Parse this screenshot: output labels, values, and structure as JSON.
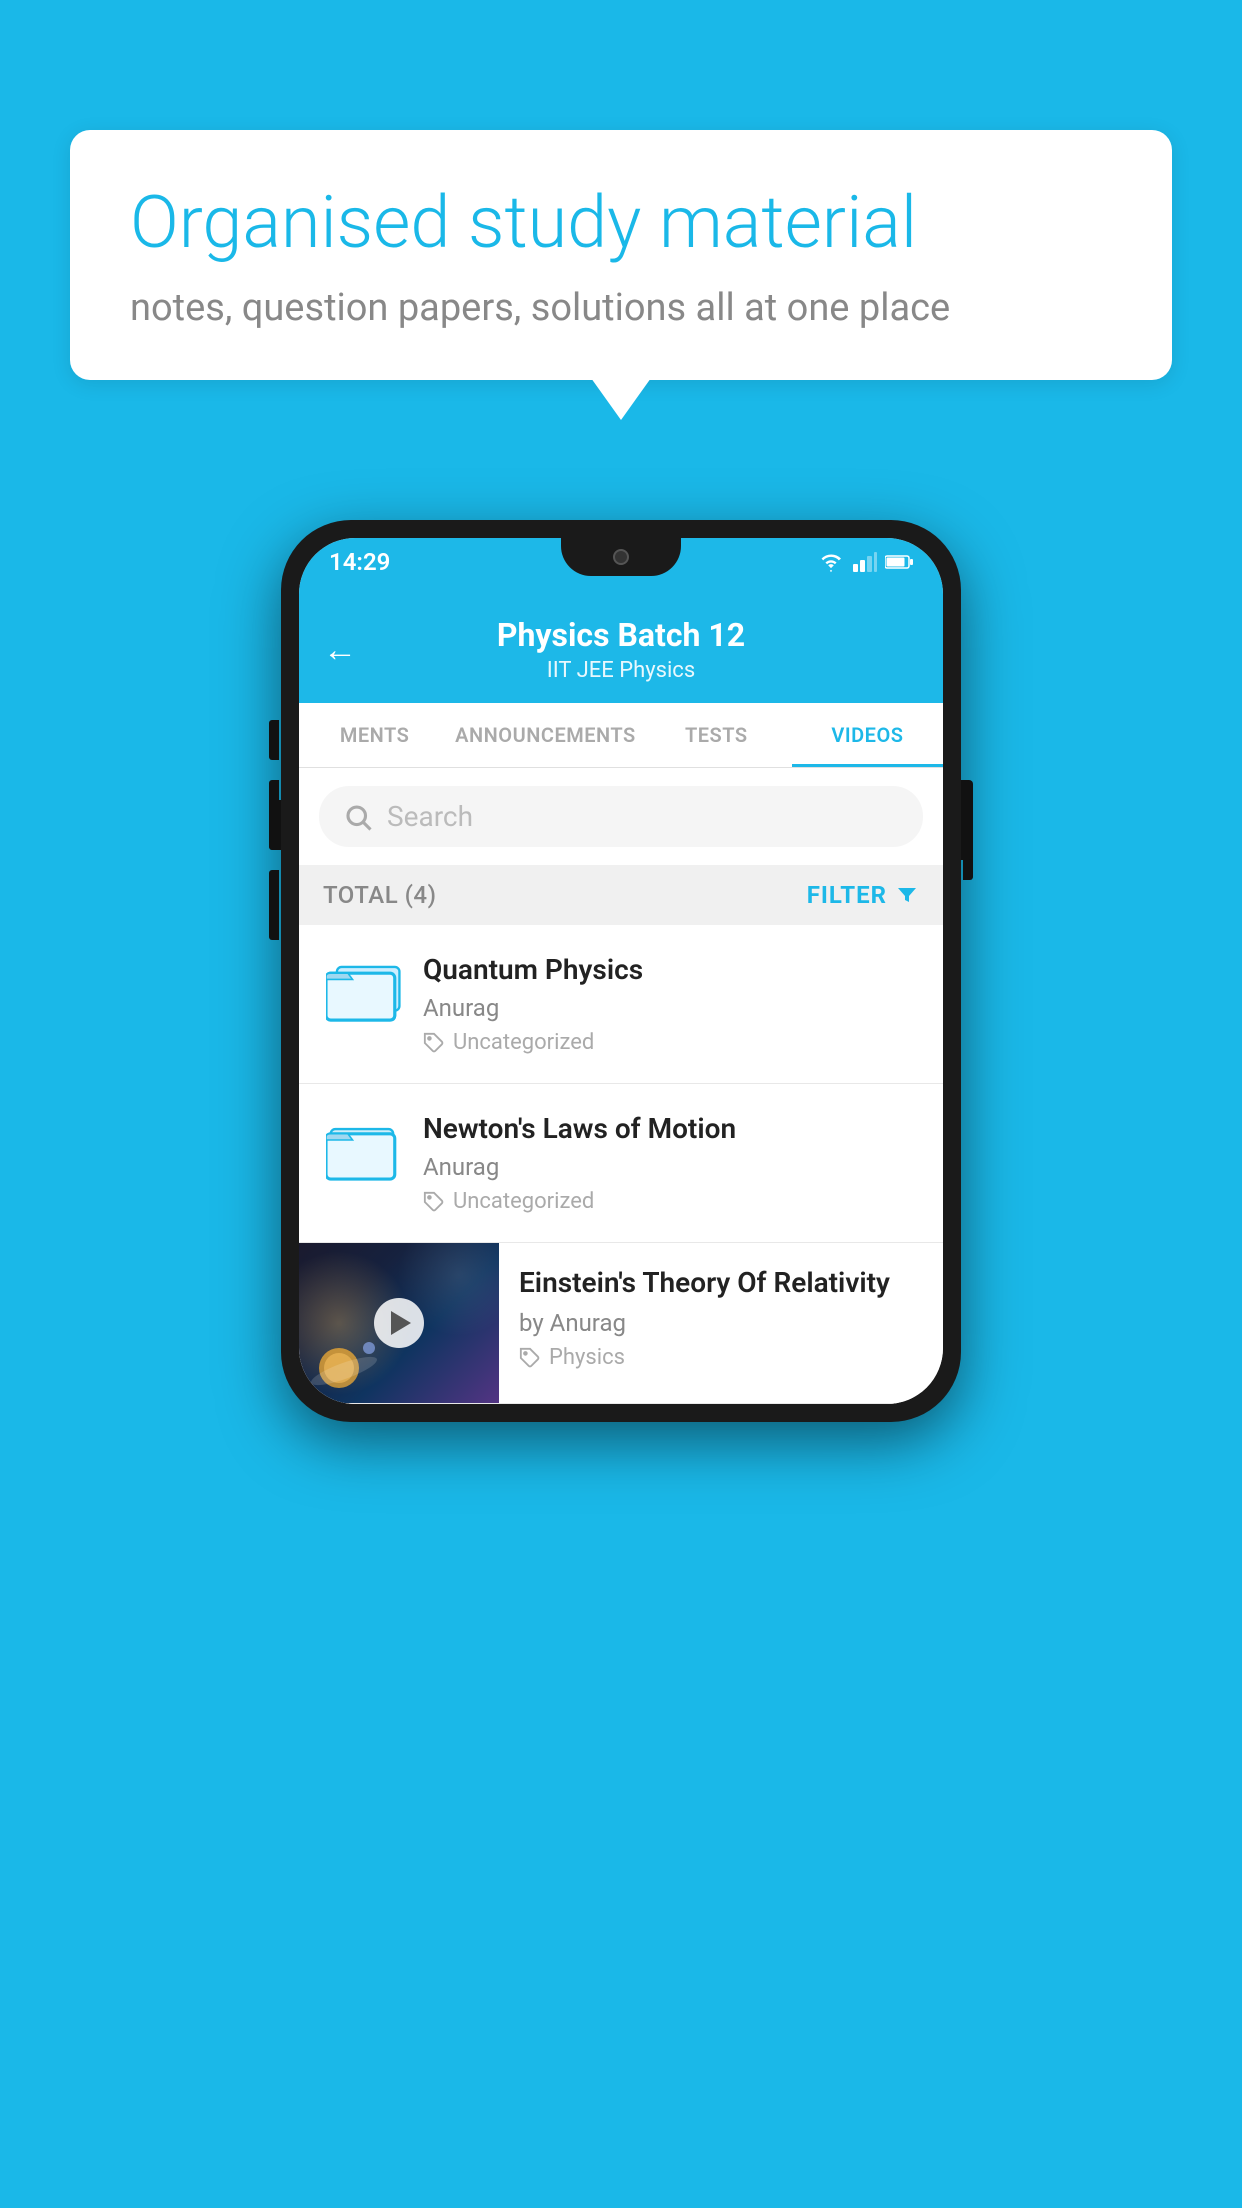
{
  "background_color": "#1ab8e8",
  "speech_bubble": {
    "title": "Organised study material",
    "subtitle": "notes, question papers, solutions all at one place"
  },
  "phone": {
    "status_bar": {
      "time": "14:29",
      "wifi": "▼",
      "signal": "▲",
      "battery": "▮"
    },
    "header": {
      "back_label": "←",
      "title": "Physics Batch 12",
      "subtitle": "IIT JEE   Physics"
    },
    "tabs": [
      {
        "label": "MENTS",
        "active": false
      },
      {
        "label": "ANNOUNCEMENTS",
        "active": false
      },
      {
        "label": "TESTS",
        "active": false
      },
      {
        "label": "VIDEOS",
        "active": true
      }
    ],
    "search": {
      "placeholder": "Search"
    },
    "filter_bar": {
      "total_label": "TOTAL (4)",
      "filter_label": "FILTER"
    },
    "videos": [
      {
        "id": 1,
        "title": "Quantum Physics",
        "author": "Anurag",
        "tag": "Uncategorized",
        "type": "folder"
      },
      {
        "id": 2,
        "title": "Newton's Laws of Motion",
        "author": "Anurag",
        "tag": "Uncategorized",
        "type": "folder"
      },
      {
        "id": 3,
        "title": "Einstein's Theory Of Relativity",
        "author": "by Anurag",
        "tag": "Physics",
        "type": "video"
      }
    ]
  }
}
